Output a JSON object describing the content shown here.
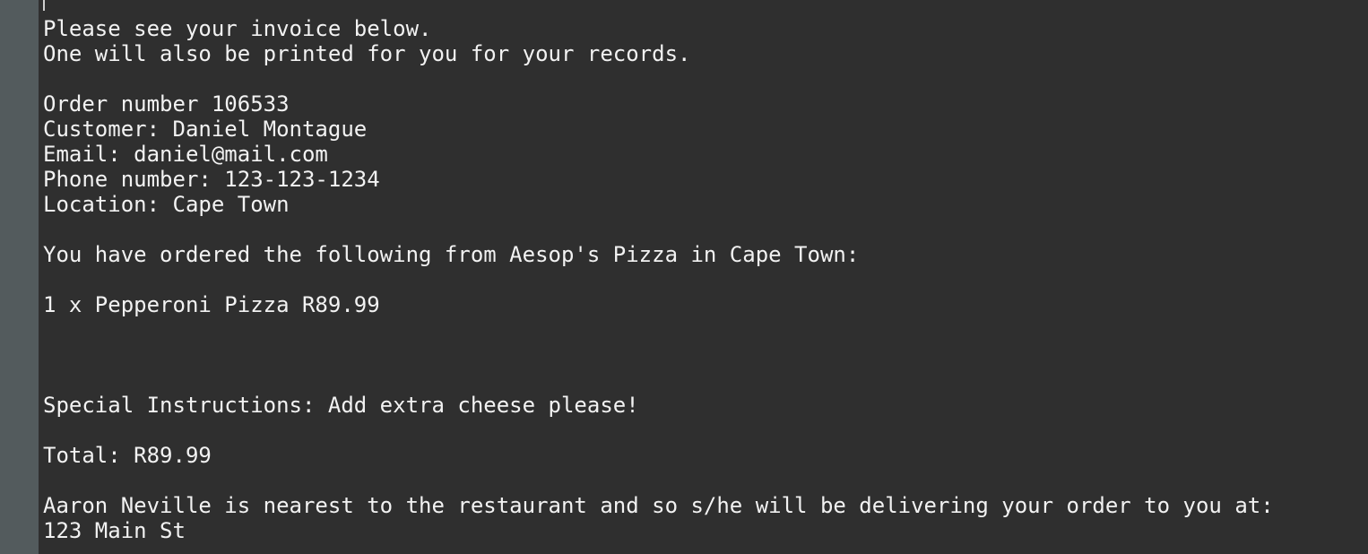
{
  "terminal": {
    "lines": [
      "Please see your invoice below.",
      "One will also be printed for you for your records.",
      "",
      "Order number 106533",
      "Customer: Daniel Montague",
      "Email: daniel@mail.com",
      "Phone number: 123-123-1234",
      "Location: Cape Town",
      "",
      "You have ordered the following from Aesop's Pizza in Cape Town:",
      "",
      "1 x Pepperoni Pizza R89.99",
      "",
      "",
      "",
      "Special Instructions: Add extra cheese please!",
      "",
      "Total: R89.99",
      "",
      "Aaron Neville is nearest to the restaurant and so s/he will be delivering your order to you at:",
      "123 Main St"
    ]
  }
}
